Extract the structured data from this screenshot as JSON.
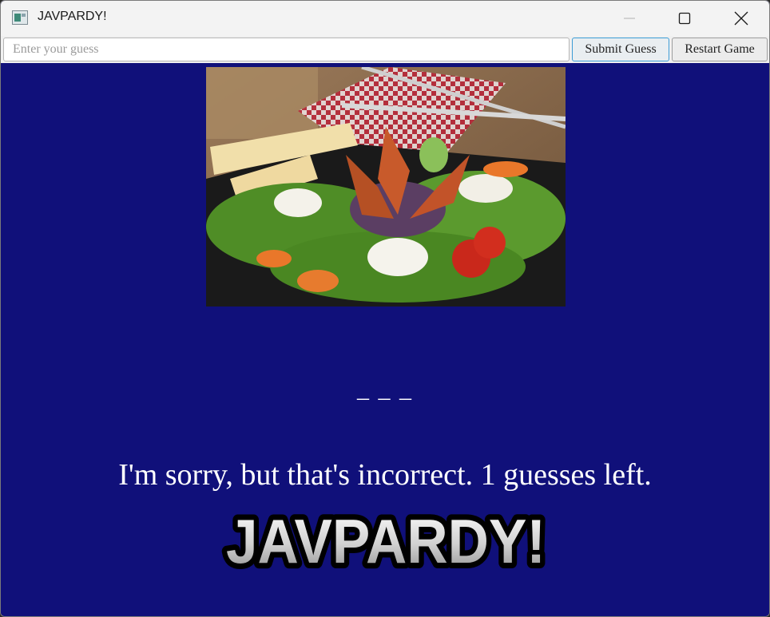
{
  "window": {
    "title": "JAVPARDY!",
    "controls": [
      "minimize-icon",
      "maximize-icon",
      "close-icon"
    ]
  },
  "toolbar": {
    "guess_input": {
      "placeholder": "Enter your guess",
      "value": ""
    },
    "submit_label": "Submit Guess",
    "restart_label": "Restart Game"
  },
  "game": {
    "answer_blanks": "_ _ _",
    "message": "I'm sorry, but that's incorrect. 1 guesses left.",
    "logo_text": "JAVPARDY!"
  },
  "colors": {
    "background": "#10107a",
    "titlebar": "#f3f3f3",
    "text": "#ffffff",
    "submit_border": "#3c9dd6"
  }
}
